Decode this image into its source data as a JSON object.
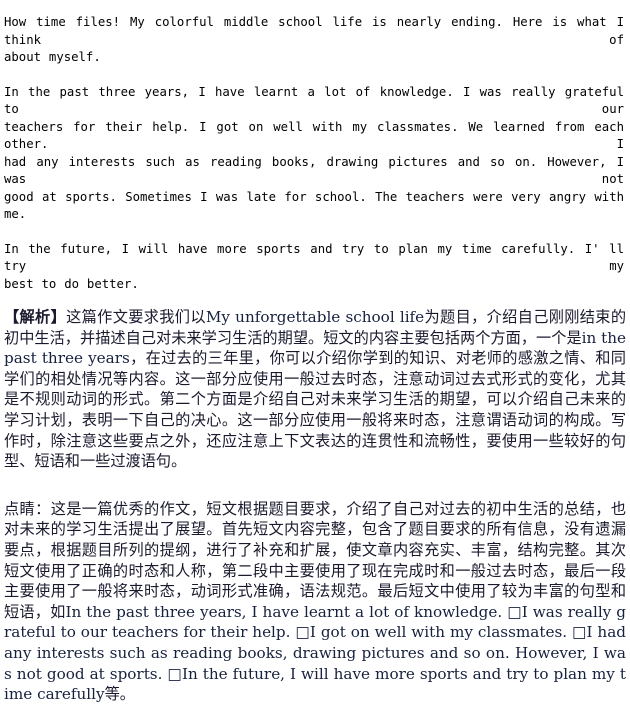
{
  "document": {
    "background_color": "#ffffff",
    "text_color": "#000000",
    "accent_color": "#16213e"
  },
  "composition": {
    "paragraphs": [
      "How time files! My colorful middle school life is nearly ending. Here is what I think of about myself.",
      "In the past three years, I have learnt a lot of knowledge. I was really grateful to our teachers for their help. I got on well with my classmates. We learned from each other. I had any interests such as reading books, drawing pictures and so on. However, I was not good at sports. Sometimes I was late for school. The teachers were very angry with me.",
      "In the future, I will have more sports and try to plan my time carefully. I' ll try my best to do better."
    ],
    "lines": [
      "How time files! My colorful middle school life is nearly ending. Here is what I think of",
      "about myself.",
      "In the past three years, I have learnt a lot of knowledge. I was really grateful to our",
      "teachers for their help. I got on well with my classmates. We learned from each other. I",
      "had any interests such as reading books, drawing pictures and so on. However, I was not",
      "good at sports. Sometimes I was late for school. The teachers were very angry with me.",
      "In the future, I will have more sports and try to plan my time carefully. I' ll try my",
      "best to do better."
    ]
  },
  "analysis": {
    "heading": "【解析】",
    "segments": [
      {
        "type": "cn",
        "text": "这篇作文要求我们以"
      },
      {
        "type": "en",
        "text": "My unforgettable school life"
      },
      {
        "type": "cn",
        "text": "为题目，介绍自己刚刚结束的初中生活，并描述自己对未来学习生活的期望。短文的内容主要包括两个方面，一个是"
      },
      {
        "type": "en",
        "text": "in the past three years"
      },
      {
        "type": "cn",
        "text": "，在过去的三年里，你可以介绍你学到的知识、对老师的感激之情、和同学们的相处情况等内容。这一部分应使用一般过去时态，注意动词过去式形式的变化，尤其是不规则动词的形式。第二个方面是介绍自己对未来学习生活的期望，可以介绍自己未来的学习计划，表明一下自己的决心。这一部分应使用一般将来时态，注意谓语动词的构成。写作时，除注意这些要点之外，还应注意上下文表达的连贯性和流畅性，要使用一些较好的句型、短语和一些过渡语句。"
      }
    ],
    "full_text": "【解析】 这篇作文要求我们以My unforgettable school life 为题目，介绍自己刚刚结束的初中生活，并描述自己对未来学习生活的期望。短文的内容主要包括两个方面，一个是in the past three years，在过去的三年里，你可以介绍你学到的知识、对老师的感激之情、和同学们的相处情况等内容。这一部分应使用一般过去时态，注意动词过去式形式的变化，尤其是不规则动词的形式。第二个方面是介绍自己对未来学习生活的期望，可以介绍自己未来的学习计划，表明一下自己的决心。这一部分应使用一般将来时态，注意谓语动词的构成。写作时，除注意这些要点之外，还应注意上下文表达的连贯性和流畅性，要使用一些较好的句型、短语和一些过渡语句。"
  },
  "tip": {
    "label": "点睛：",
    "body_cn_1": "这是一篇优秀的作文，短文根据题目要求，介绍了自己对过去的初中生活的总结，也对未来的学习生活提出了展望。首先短文内容完整，包含了题目要求的所有信息，没有遗漏要点，根据题目所列的提纲，进行了补充和扩展，使文章内容充实、丰富，结构完整。其次短文使用了正确的时态和人称，第二段中主要使用了现在完成时和一般过去时态，最后一段主要使用了一般将来时态，动词形式准确，语法规范。最后短文中使用了较为丰富的句型和短语，如",
    "example_en": "In the past three years, I have learnt a lot of knowledge. □I was really grateful to our teachers for their help. □I got on well with my classmates. □I had any interests such as reading books, drawing pictures and so on. However, I was not good at sports. □In the future, I will have more sports and try to plan my time carefully",
    "body_cn_2": "等。",
    "tofu_char": "□",
    "full_text": "点睛：这是一篇优秀的作文，短文根据题目要求，介绍了自己对过去的初中生活的总结，也对未来的学习生活提出了展望。首先短文内容完整，包含了题目要求的所有信息，没有遗漏要点，根据题目所列的提纲，进行了补充和扩展，使文章内容充实、丰富，结构完整。其次短文使用了正确的时态和人称，第二段中主要使用了现在完成时和一般过去时态，最后一段主要使用了一般将来时态，动词形式准确，语法规范。最后短文中使用了较为丰富的句型和短语，如In the past three years, I have learnt a lot of knowledge. □I was really grateful to our teachers for their help. □I got on well with my classmates. □I had any interests such as reading books, drawing pictures and so on. However, I was not good at sports. □In the future, I will have more sports and try to plan my time carefully等。"
  }
}
